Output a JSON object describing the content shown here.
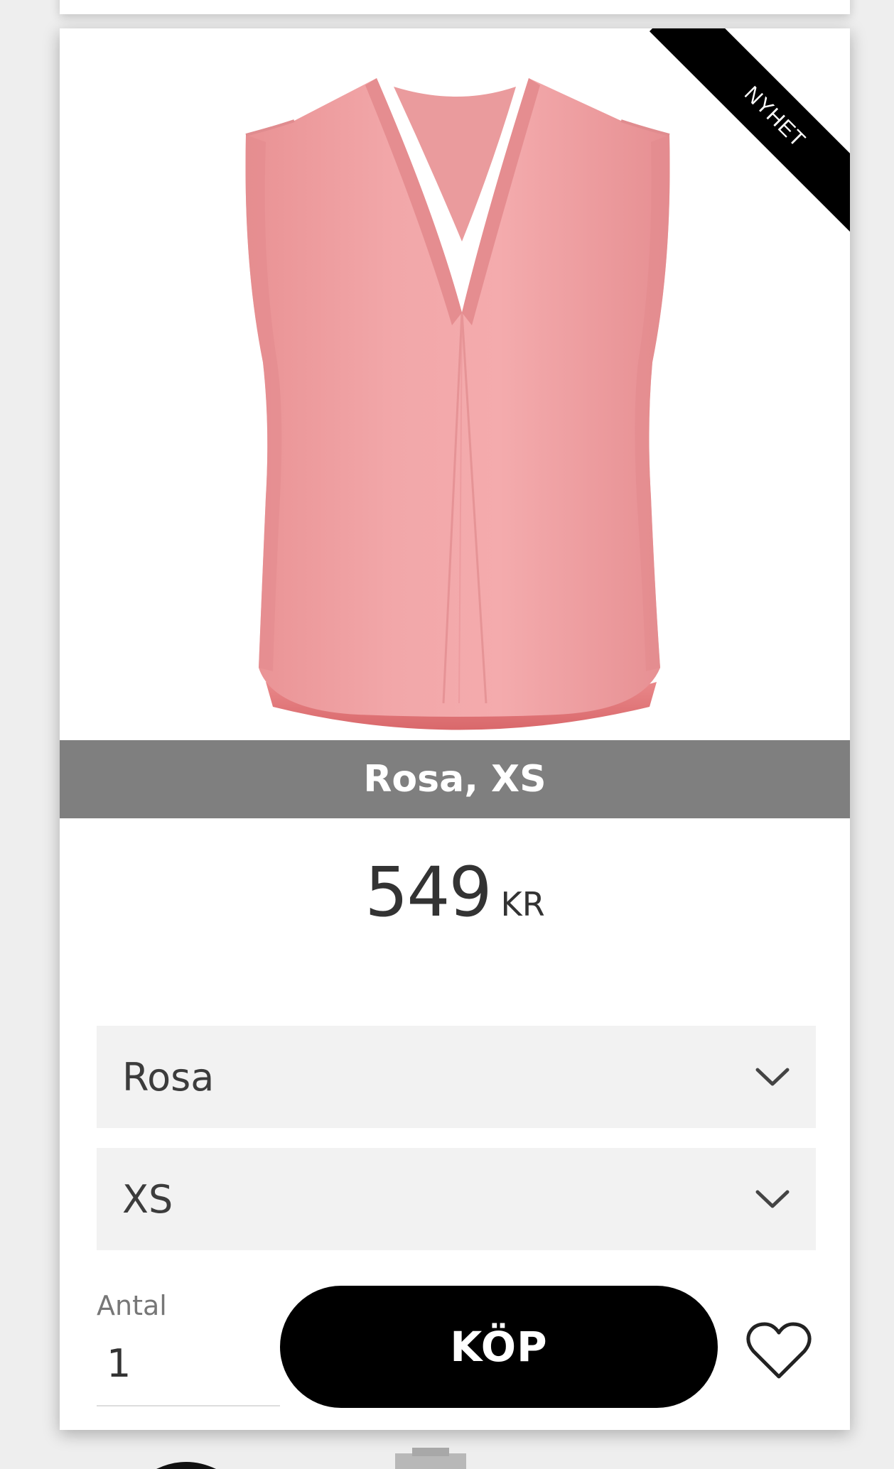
{
  "product": {
    "badge": "NYHET",
    "variant_label": "Rosa, XS",
    "image_icon": "pink-sleeveless-blouse-image",
    "image_color": "#f0a4a6",
    "price": {
      "amount": "549",
      "currency": "KR"
    }
  },
  "selectors": {
    "color": {
      "value": "Rosa",
      "icon": "chevron-down-icon"
    },
    "size": {
      "value": "XS",
      "icon": "chevron-down-icon"
    }
  },
  "purchase": {
    "quantity_label": "Antal",
    "quantity_value": "1",
    "buy_label": "KÖP",
    "favorite_icon": "heart-outline-icon"
  },
  "colors": {
    "button": "#000000",
    "variant_bar": "#7f7f7f",
    "select_bg": "#f2f2f2"
  }
}
